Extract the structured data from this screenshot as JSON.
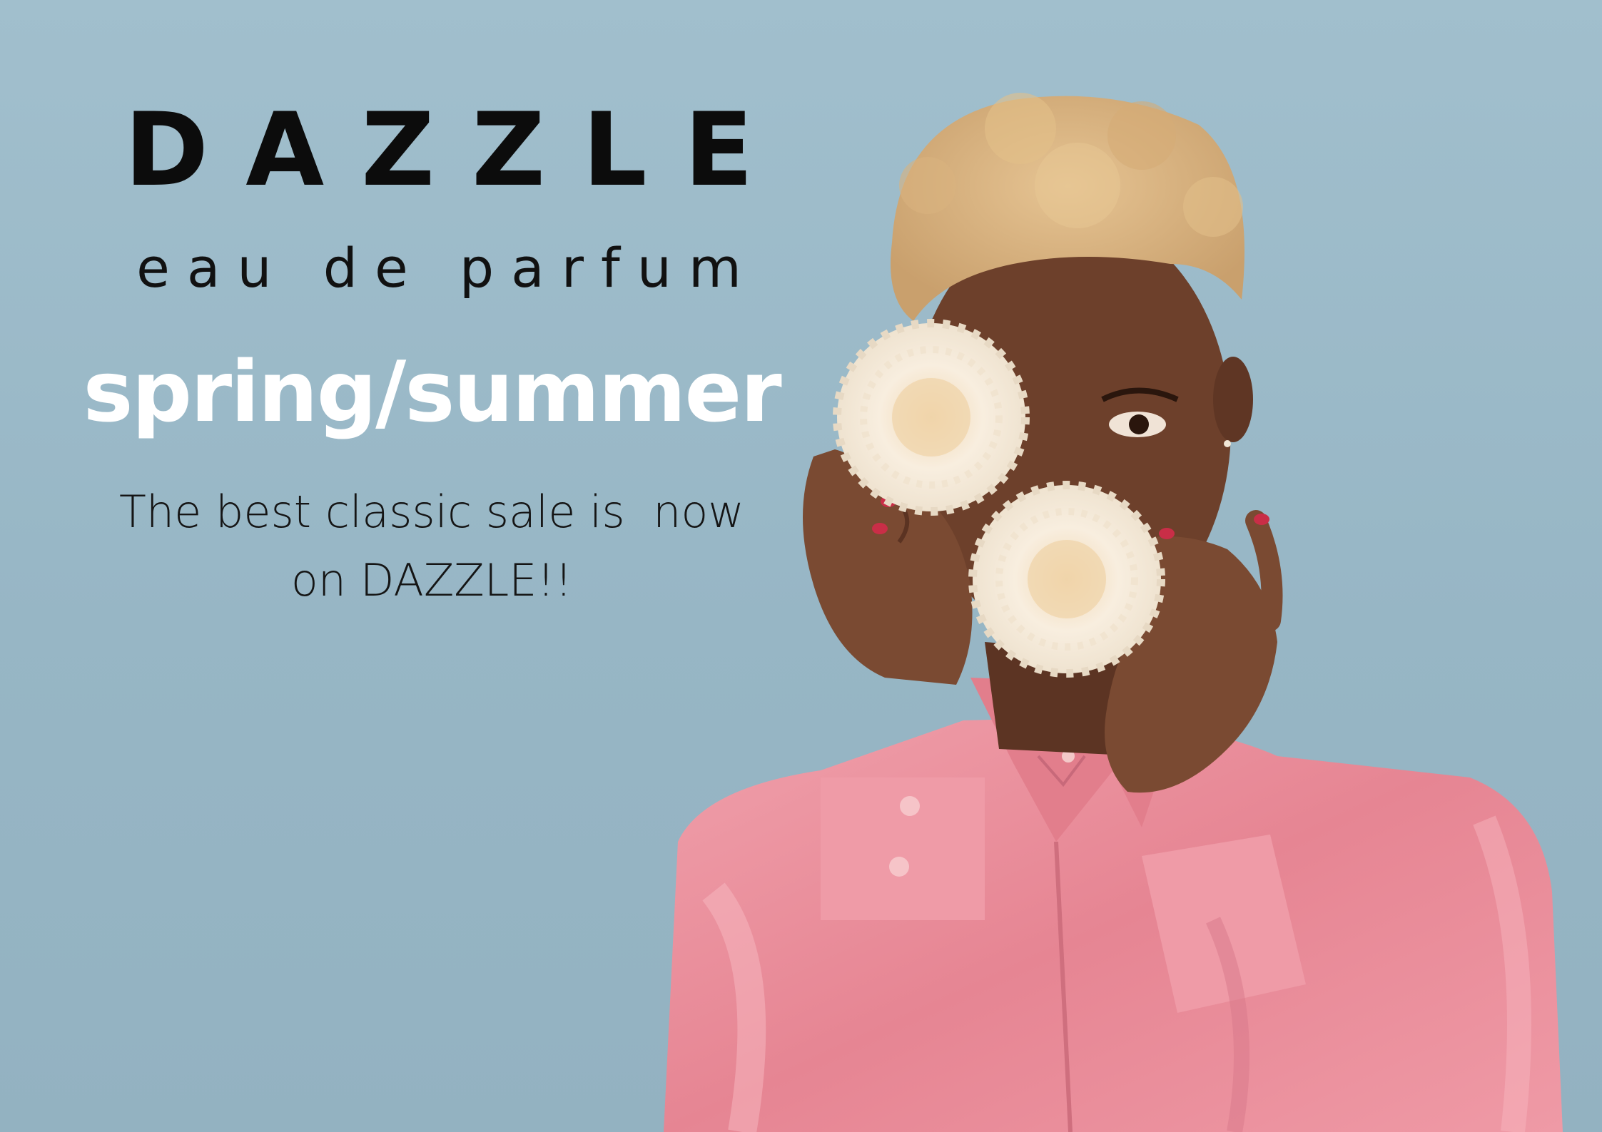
{
  "poster": {
    "brand": "DAZZLE",
    "subtitle": "eau de parfum",
    "season": "spring/summer",
    "promo_line_1": "The best classic sale is  now",
    "promo_line_2": "on DAZZLE!!"
  },
  "colors": {
    "background": "#9bbac9",
    "brand_text": "#0c0c0c",
    "season_text": "#ffffff",
    "shirt": "#e98e9a",
    "hair": "#d9b27e",
    "skin": "#6b3f2a",
    "flower": "#f6ecdc"
  }
}
